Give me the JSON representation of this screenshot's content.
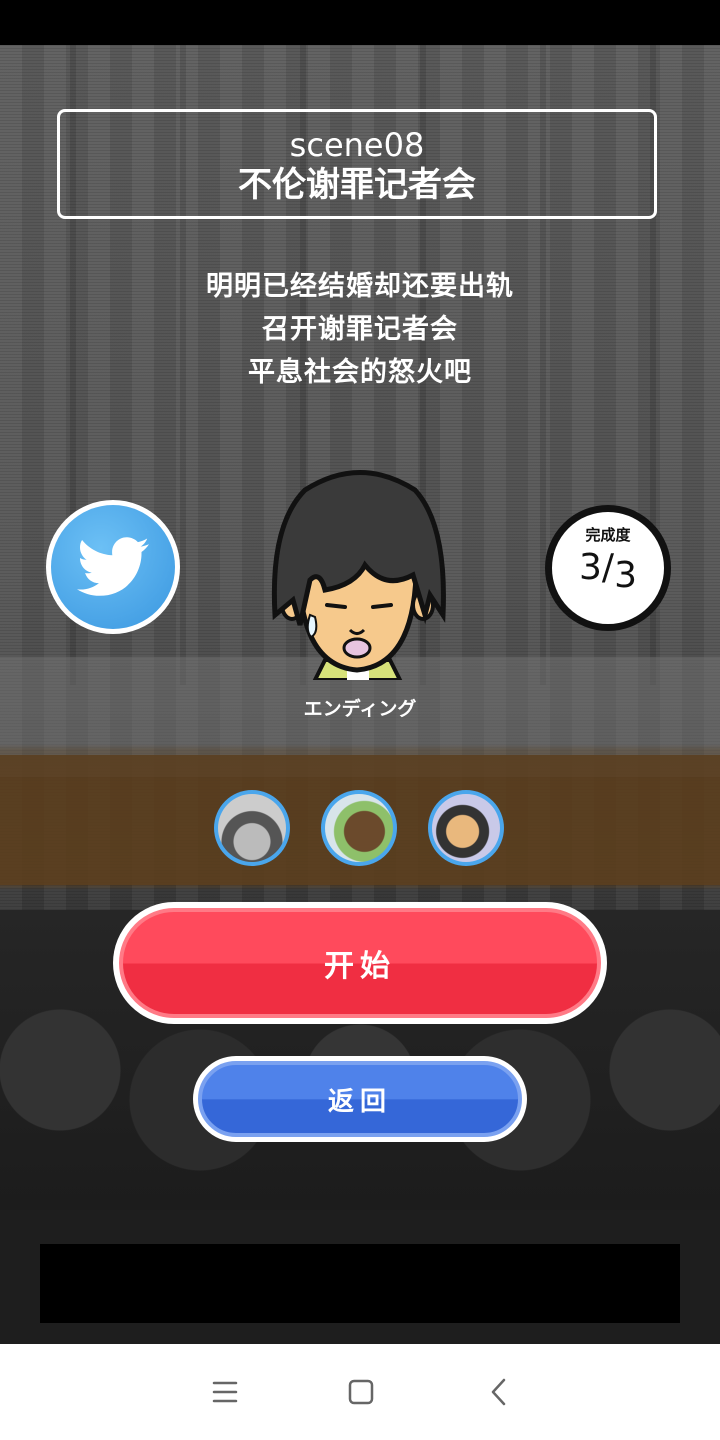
{
  "scene": {
    "id": "scene08",
    "title": "不伦谢罪记者会",
    "description": [
      "明明已经结婚却还要出轨",
      "召开谢罪记者会",
      "平息社会的怒火吧"
    ]
  },
  "character": {
    "ending_label": "エンディング"
  },
  "progress": {
    "label": "完成度",
    "current": "3",
    "total": "3"
  },
  "buttons": {
    "start": "开始",
    "back": "返回"
  },
  "icons": {
    "share": "twitter-icon",
    "nav": [
      "menu-icon",
      "home-square-icon",
      "back-chevron-icon"
    ]
  },
  "colors": {
    "start_button": "#f02e42",
    "back_button": "#3567d8",
    "twitter": "#4aa6ec"
  }
}
